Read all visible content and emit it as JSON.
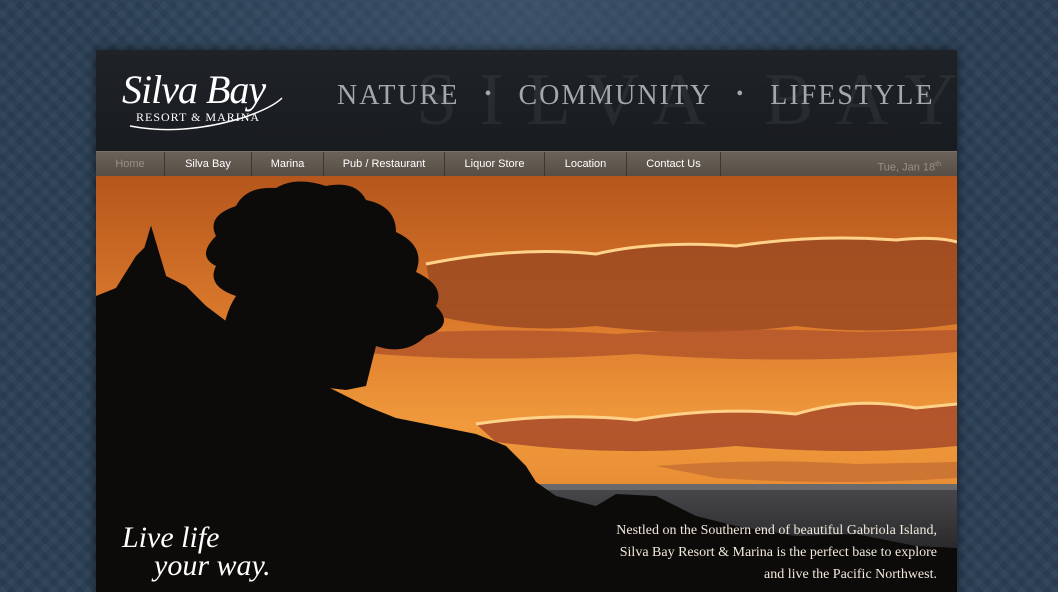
{
  "logo": {
    "title": "Silva Bay",
    "subtitle": "RESORT & MARINA"
  },
  "header": {
    "watermark": "SILVA BAY",
    "tagline": [
      "NATURE",
      "COMMUNITY",
      "LIFESTYLE"
    ],
    "separator": "•"
  },
  "nav": {
    "items": [
      "Home",
      "Silva Bay",
      "Marina",
      "Pub / Restaurant",
      "Liquor Store",
      "Location",
      "Contact Us"
    ],
    "date": "Tue, Jan 18",
    "date_suffix": "th"
  },
  "hero": {
    "slogan_line1": "Live life",
    "slogan_line2": "your way.",
    "blurb": "Nestled on the Southern end of beautiful Gabriola Island, Silva Bay Resort & Marina is the perfect base to explore and live the Pacific Northwest."
  },
  "colors": {
    "background": "#2a3f55",
    "header": "#1b1e22",
    "nav": "#5f564d",
    "sunset": "#e8862e"
  }
}
